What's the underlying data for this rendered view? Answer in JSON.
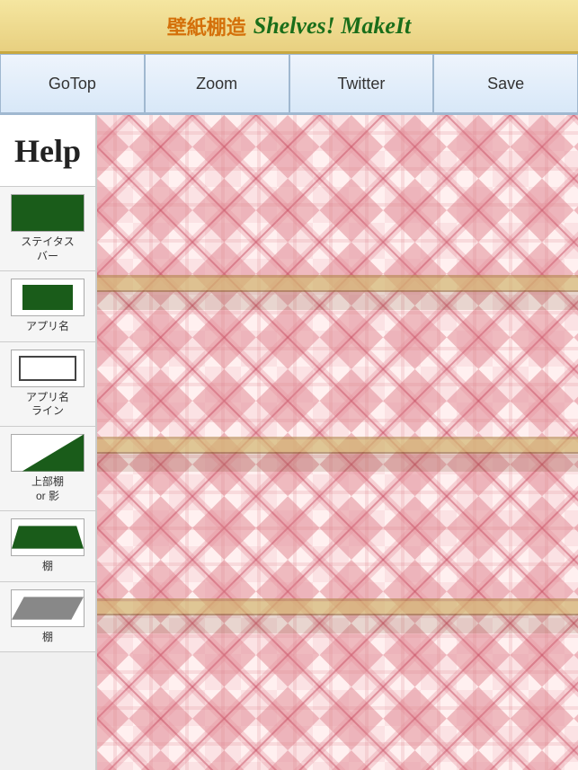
{
  "header": {
    "title_jp": "壁紙棚造",
    "title_en": "Shelves! MakeIt"
  },
  "toolbar": {
    "buttons": [
      {
        "label": "GoTop",
        "id": "gotop"
      },
      {
        "label": "Zoom",
        "id": "zoom"
      },
      {
        "label": "Twitter",
        "id": "twitter"
      },
      {
        "label": "Save",
        "id": "save"
      }
    ]
  },
  "sidebar": {
    "help_label": "Help",
    "items": [
      {
        "id": "status-bar",
        "icon_type": "green-filled",
        "label": "ステイタス\nバー"
      },
      {
        "id": "app-name",
        "icon_type": "green-filled-small",
        "label": "アプリ名"
      },
      {
        "id": "app-name-line",
        "icon_type": "outline",
        "label": "アプリ名\nライン"
      },
      {
        "id": "top-shelf-shadow",
        "icon_type": "shelf-top",
        "label": "上部棚\nor 影"
      },
      {
        "id": "shelf-1",
        "icon_type": "shelf-para",
        "label": "棚"
      },
      {
        "id": "shelf-2",
        "icon_type": "shelf-para-light",
        "label": "棚"
      }
    ]
  },
  "wallpaper": {
    "description": "Pink plaid/tartan pattern",
    "shelf_positions": [
      180,
      360,
      540
    ]
  }
}
